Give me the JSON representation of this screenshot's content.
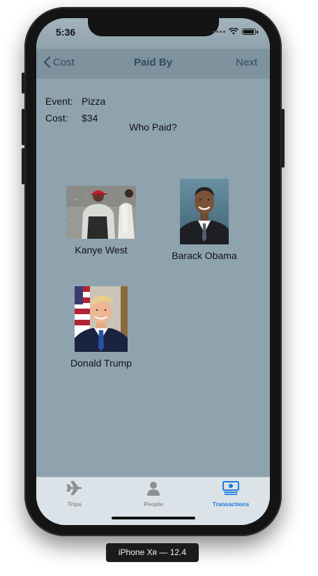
{
  "status_bar": {
    "time": "5:36"
  },
  "nav": {
    "back_label": "Cost",
    "title": "Paid By",
    "next_label": "Next"
  },
  "event": {
    "label": "Event:",
    "value": "Pizza"
  },
  "cost": {
    "label": "Cost:",
    "value": "$34"
  },
  "prompt": "Who Paid?",
  "people": [
    {
      "name": "Kanye West"
    },
    {
      "name": "Barack Obama"
    },
    {
      "name": "Donald Trump"
    }
  ],
  "tabs": [
    {
      "label": "Trips",
      "icon": "airplane-icon",
      "active": false
    },
    {
      "label": "People",
      "icon": "person-icon",
      "active": false
    },
    {
      "label": "Transactions",
      "icon": "money-icon",
      "active": true
    }
  ],
  "device_label": "iPhone Xʀ — 12.4",
  "colors": {
    "tint": "#2f4f5c",
    "background": "#8fa3af",
    "tab_active": "#1f7ae0",
    "tab_inactive": "#8e8e93"
  }
}
